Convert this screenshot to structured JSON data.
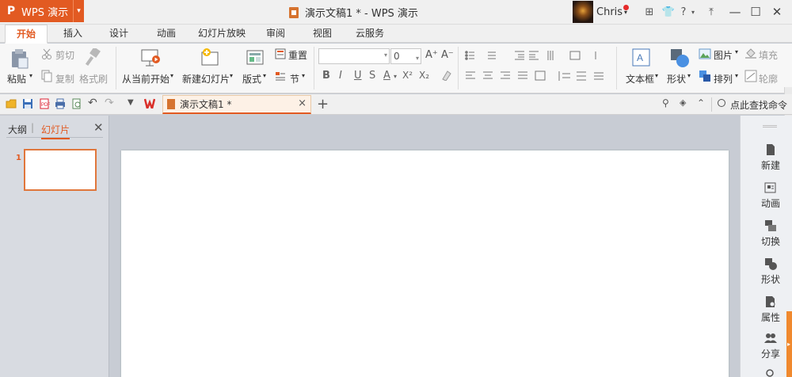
{
  "app": {
    "logo": "P",
    "name": "WPS 演示",
    "dropdown": "▾",
    "window_title": "演示文稿1 * - WPS 演示"
  },
  "user": {
    "name": "Chris",
    "caret": "▾"
  },
  "title_icons": [
    {
      "icon": "skin-icon",
      "glyph": "⊞"
    },
    {
      "icon": "shirt-icon",
      "glyph": "👕"
    },
    {
      "icon": "help-icon",
      "glyph": "?"
    },
    {
      "icon": "help-caret-icon",
      "glyph": "▾"
    },
    {
      "icon": "restore-icon",
      "glyph": "⤒"
    }
  ],
  "window_buttons": {
    "minimize": "—",
    "maximize": "☐",
    "close": "✕"
  },
  "tabs": [
    "开始",
    "插入",
    "设计",
    "动画",
    "幻灯片放映",
    "审阅",
    "视图",
    "云服务"
  ],
  "active_tab": "开始",
  "ribbon": {
    "paste": "粘贴",
    "cut": "剪切",
    "copy": "复制",
    "format_painter": "格式刷",
    "from_current": "从当前开始",
    "new_slide": "新建幻灯片",
    "layout": "版式",
    "reset": "重置",
    "section": "节",
    "font_name": "",
    "font_size": "0",
    "text_box": "文本框",
    "shape": "形状",
    "picture": "图片",
    "fill": "填充",
    "arrange": "排列",
    "outline": "轮廓",
    "bold": "B",
    "italic": "I",
    "underline": "U",
    "strike": "S",
    "font_color": "A",
    "superscript": "X²",
    "subscript": "X₂",
    "grow_font": "A⁺",
    "shrink_font": "A⁻"
  },
  "quick_access": {
    "doc_tab": "演示文稿1 *",
    "close_tab": "×",
    "new_tab": "+",
    "search_command": "点此查找命令"
  },
  "left_panel": {
    "tab_outline": "大纲",
    "tab_slides": "幻灯片",
    "close": "✕",
    "slide_number": "1"
  },
  "right_sidebar": [
    {
      "label": "新建",
      "icon": "new-icon"
    },
    {
      "label": "动画",
      "icon": "animation-icon"
    },
    {
      "label": "切换",
      "icon": "switch-icon"
    },
    {
      "label": "形状",
      "icon": "shape-icon"
    },
    {
      "label": "属性",
      "icon": "property-icon"
    },
    {
      "label": "分享",
      "icon": "share-icon"
    }
  ],
  "colors": {
    "accent": "#e25a22",
    "thumb_border": "#e0773c",
    "scroll_accent": "#f0892e",
    "canvas_bg": "#c8ccd4"
  }
}
